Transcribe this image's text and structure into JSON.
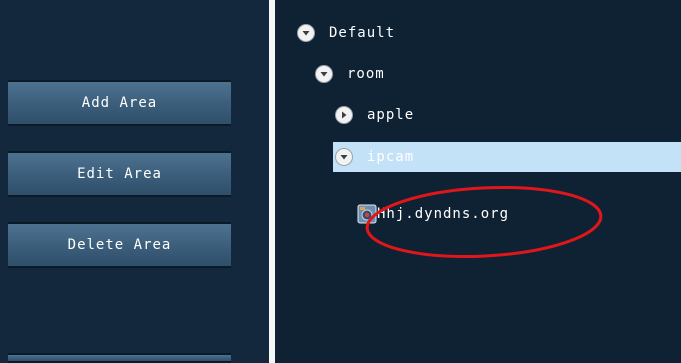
{
  "left_panel": {
    "buttons": [
      {
        "label": "Add Area"
      },
      {
        "label": "Edit Area"
      },
      {
        "label": "Delete Area"
      }
    ]
  },
  "tree": {
    "root": {
      "label": "Default",
      "state": "expanded"
    },
    "room": {
      "label": "room",
      "state": "expanded"
    },
    "apple": {
      "label": "apple",
      "state": "collapsed"
    },
    "ipcam": {
      "label": "ipcam",
      "state": "expanded",
      "selected": true
    },
    "device": {
      "label": "Hhj.dyndns.org",
      "icon": "camera-icon"
    }
  },
  "colors": {
    "background": "#0e2234",
    "button": "#3c5f7c",
    "selection": "#c3e2f7",
    "annotation": "#e0161b"
  }
}
